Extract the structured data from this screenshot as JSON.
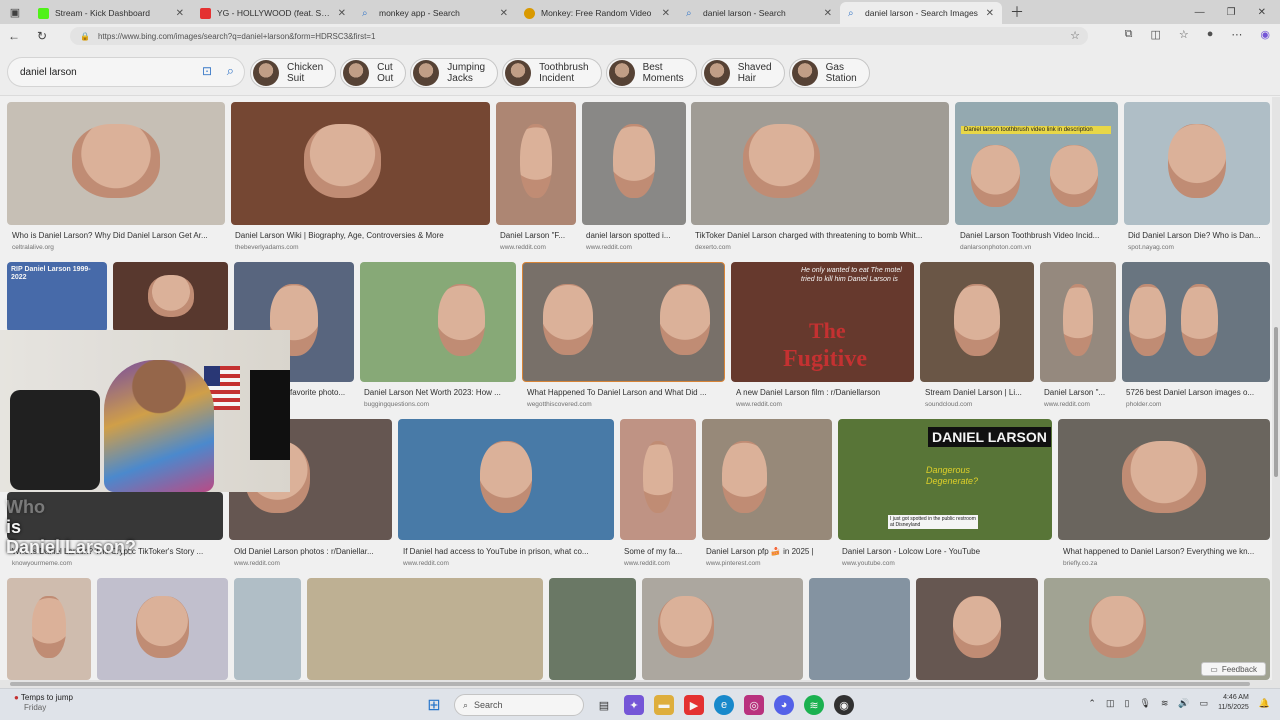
{
  "browser": {
    "tabs": [
      {
        "title": "Stream - Kick Dashboard",
        "color": "#53fc18"
      },
      {
        "title": "YG - HOLLYWOOD (feat. Shoreline",
        "color": "#e33"
      },
      {
        "title": "monkey app - Search",
        "color": "#3d7fd1"
      },
      {
        "title": "Monkey: Free Random Video",
        "color": "#e2a000"
      },
      {
        "title": "daniel larson - Search",
        "color": "#3d7fd1"
      },
      {
        "title": "daniel larson - Search Images",
        "color": "#3d7fd1"
      }
    ],
    "url": "https://www.bing.com/images/search?q=daniel+larson&form=HDRSC3&first=1"
  },
  "search": {
    "query": "daniel larson",
    "chips": [
      {
        "line1": "Chicken",
        "line2": "Suit"
      },
      {
        "line1": "Cut",
        "line2": "Out"
      },
      {
        "line1": "Jumping",
        "line2": "Jacks"
      },
      {
        "line1": "Toothbrush",
        "line2": "Incident"
      },
      {
        "line1": "Best",
        "line2": "Moments"
      },
      {
        "line1": "Shaved",
        "line2": "Hair"
      },
      {
        "line1": "Gas",
        "line2": "Station"
      }
    ]
  },
  "results": [
    {
      "caption": "Who is Daniel Larson? Why Did Daniel Larson Get Ar...",
      "source": "celtralalive.org",
      "tone": "#cfc7bd"
    },
    {
      "caption": "Daniel Larson Wiki | Biography, Age, Controversies & More",
      "source": "thebeverlyadams.com",
      "tone": "#7a4a36"
    },
    {
      "caption": "Daniel Larson \"F...",
      "source": "www.reddit.com",
      "tone": "#b58c78"
    },
    {
      "caption": "daniel larson spotted i...",
      "source": "www.reddit.com",
      "tone": "#8f8e8c"
    },
    {
      "caption": "TikToker Daniel Larson charged with threatening to bomb Whit...",
      "source": "dexerto.com",
      "tone": "#a7a39c"
    },
    {
      "caption": "Daniel Larson Toothbrush Video Incid...",
      "source": "danlarsonphoton.com.vn",
      "tone": "#9bb0b8"
    },
    {
      "caption": "Did Daniel Larson Die? Who is Dan...",
      "source": "spot.nayag.com",
      "tone": "#b7c6cf"
    },
    {
      "caption": "favorite photo...",
      "source": "",
      "tone": "#5c6a84"
    },
    {
      "caption": "Daniel Larson Net Worth 2023: How ...",
      "source": "buggingquestions.com",
      "tone": "#8db07c"
    },
    {
      "caption": "What Happened To Daniel Larson and What Did ...",
      "source": "wegotthiscovered.com",
      "tone": "#7d756e"
    },
    {
      "caption": "A new Daniel Larson film : r/Daniellarson",
      "source": "www.reddit.com",
      "tone": "#6b3c2f"
    },
    {
      "caption": "Stream Daniel Larson | Li...",
      "source": "soundcloud.com",
      "tone": "#6f5a49"
    },
    {
      "caption": "Daniel Larson \"...",
      "source": "www.reddit.com",
      "tone": "#9c8f84"
    },
    {
      "caption": "5726 best Daniel Larson images o...",
      "source": "pholder.com",
      "tone": "#6e7a86"
    },
    {
      "caption": "Who Is Daniel Larson? The Cryptic TikToker's Story ...",
      "source": "knowyourmeme.com",
      "tone": "#3a3a3a"
    },
    {
      "caption": "Old Daniel Larson photos : r/Daniellar...",
      "source": "www.reddit.com",
      "tone": "#6a5a55"
    },
    {
      "caption": "If Daniel had access to YouTube in prison, what co...",
      "source": "www.reddit.com",
      "tone": "#4b7fae"
    },
    {
      "caption": "Some of my fa...",
      "source": "www.reddit.com",
      "tone": "#c79a8a"
    },
    {
      "caption": "Daniel Larson pfp 🍰 in 2025 |",
      "source": "www.pinterest.com",
      "tone": "#9e8f7e"
    },
    {
      "caption": "Daniel Larson - Lolcow Lore - YouTube",
      "source": "www.youtube.com",
      "tone": "#5c7a3a"
    },
    {
      "caption": "What happened to Daniel Larson? Everything we kn...",
      "source": "briefly.co.za",
      "tone": "#6f6a62"
    }
  ],
  "overlay": {
    "title_line1": "Who",
    "title_line2": "is",
    "title_line3": "Daniel Larson?",
    "toothbrush_note": "Daniel larson toothbrush video link in description",
    "fugitive_top": "He only wanted to eat The motel tried to kill him Daniel Larson is",
    "fugitive_big1": "The",
    "fugitive_big2": "Fugitive",
    "lolcow_banner": "DANIEL LARSON",
    "lolcow_sub": "Dangerous Degenerate?",
    "lolcow_note": "I just got spotted in the public restroom at Disneyland",
    "memorial": "RIP Daniel Larson 1999-2022"
  },
  "feedback": "Feedback",
  "taskbar": {
    "weather_line1": "Temps to jump",
    "weather_line2": "Friday",
    "search_label": "Search",
    "time": "4:46 AM",
    "date": "11/5/2025"
  }
}
